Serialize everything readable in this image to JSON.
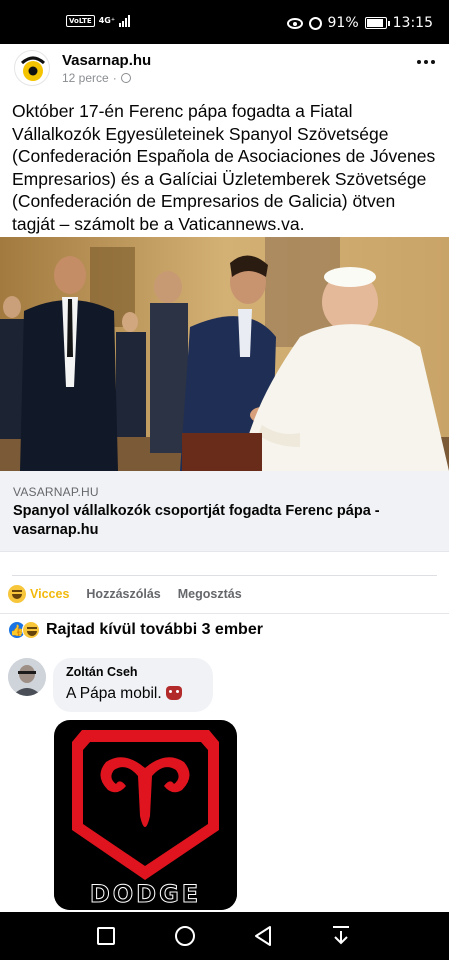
{
  "status_bar": {
    "volte": "VoLTE",
    "network": "4G⁺",
    "battery": "91%",
    "battery_level": 0.91,
    "time": "13:15"
  },
  "post": {
    "page_name": "Vasarnap.hu",
    "time_ago": "12 perce",
    "separator": "·",
    "text": "Október 17-én Ferenc pápa fogadta a Fiatal Vállalkozók Egyesületeinek Spanyol Szövetsége (Confederación Española de Asociaciones de Jóvenes Empresarios) és a Galíciai Üzletemberek Szövetsége (Confederación de Empresarios de Galicia) ötven tagját – számolt be a Vaticannews.va."
  },
  "link_preview": {
    "domain": "VASARNAP.HU",
    "title": "Spanyol vállalkozók csoportját fogadta Ferenc pápa - vasarnap.hu"
  },
  "actions": {
    "reaction": "Vicces",
    "comment": "Hozzászólás",
    "share": "Megosztás"
  },
  "reactions_summary": "Rajtad kívül további 3 ember",
  "comment": {
    "author": "Zoltán Cseh",
    "text": "A Pápa mobil."
  },
  "sticker": {
    "brand": "DODGE"
  },
  "colors": {
    "accent_blue": "#1b74e4",
    "haha_yellow": "#f2b90c",
    "dodge_red": "#e0141e"
  }
}
